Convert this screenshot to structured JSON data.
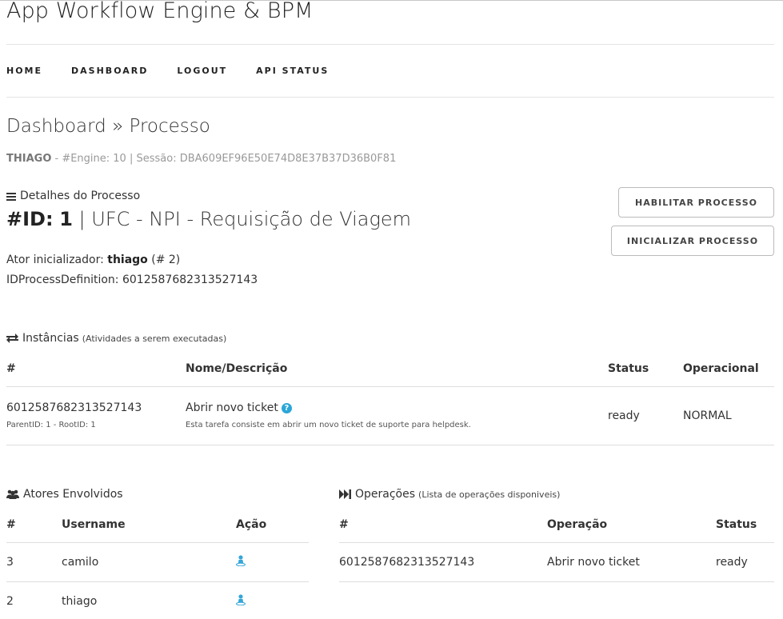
{
  "header": {
    "title": "App Workflow Engine & BPM"
  },
  "nav": {
    "items": [
      "HOME",
      "DASHBOARD",
      "LOGOUT",
      "API STATUS"
    ]
  },
  "page": {
    "title": "Dashboard » Processo",
    "session": {
      "user": "THIAGO",
      "rest": " - #Engine: 10 | Sessão: DBA609EF96E50E74D8E37B37D36B0F81"
    }
  },
  "details": {
    "label": "Detalhes do Processo",
    "id_prefix": "#ID:",
    "id_value": "1",
    "process_name": "| UFC - NPI - Requisição de Viagem",
    "actor_label": "Ator inicializador:",
    "actor_name": "thiago",
    "actor_id": "(# 2)",
    "definition": "IDProcessDefinition: 6012587682313527143",
    "buttons": {
      "enable": "HABILITAR PROCESSO",
      "start": "INICIALIZAR PROCESSO"
    }
  },
  "instances": {
    "label": "Instâncias",
    "sublabel": "(Atividades a serem executadas)",
    "columns": [
      "#",
      "Nome/Descrição",
      "Status",
      "Operacional"
    ],
    "rows": [
      {
        "id": "6012587682313527143",
        "parent": "ParentID: 1 - RootID: 1",
        "name": "Abrir novo ticket",
        "help": "?",
        "description": "Esta tarefa consiste em abrir um novo ticket de suporte para helpdesk.",
        "status": "ready",
        "operational": "NORMAL"
      }
    ]
  },
  "actors": {
    "label": "Atores Envolvidos",
    "columns": [
      "#",
      "Username",
      "Ação"
    ],
    "rows": [
      {
        "id": "3",
        "username": "camilo",
        "action_icon": "user-icon"
      },
      {
        "id": "2",
        "username": "thiago",
        "action_icon": "user-icon"
      }
    ]
  },
  "operations": {
    "label": "Operações",
    "sublabel": "(Lista de operações disponiveis)",
    "columns": [
      "#",
      "Operação",
      "Status"
    ],
    "rows": [
      {
        "id": "6012587682313527143",
        "operation": "Abrir novo ticket",
        "status": "ready"
      }
    ]
  },
  "colors": {
    "accent": "#2aa6d8",
    "divider": "#e4e4e4"
  }
}
